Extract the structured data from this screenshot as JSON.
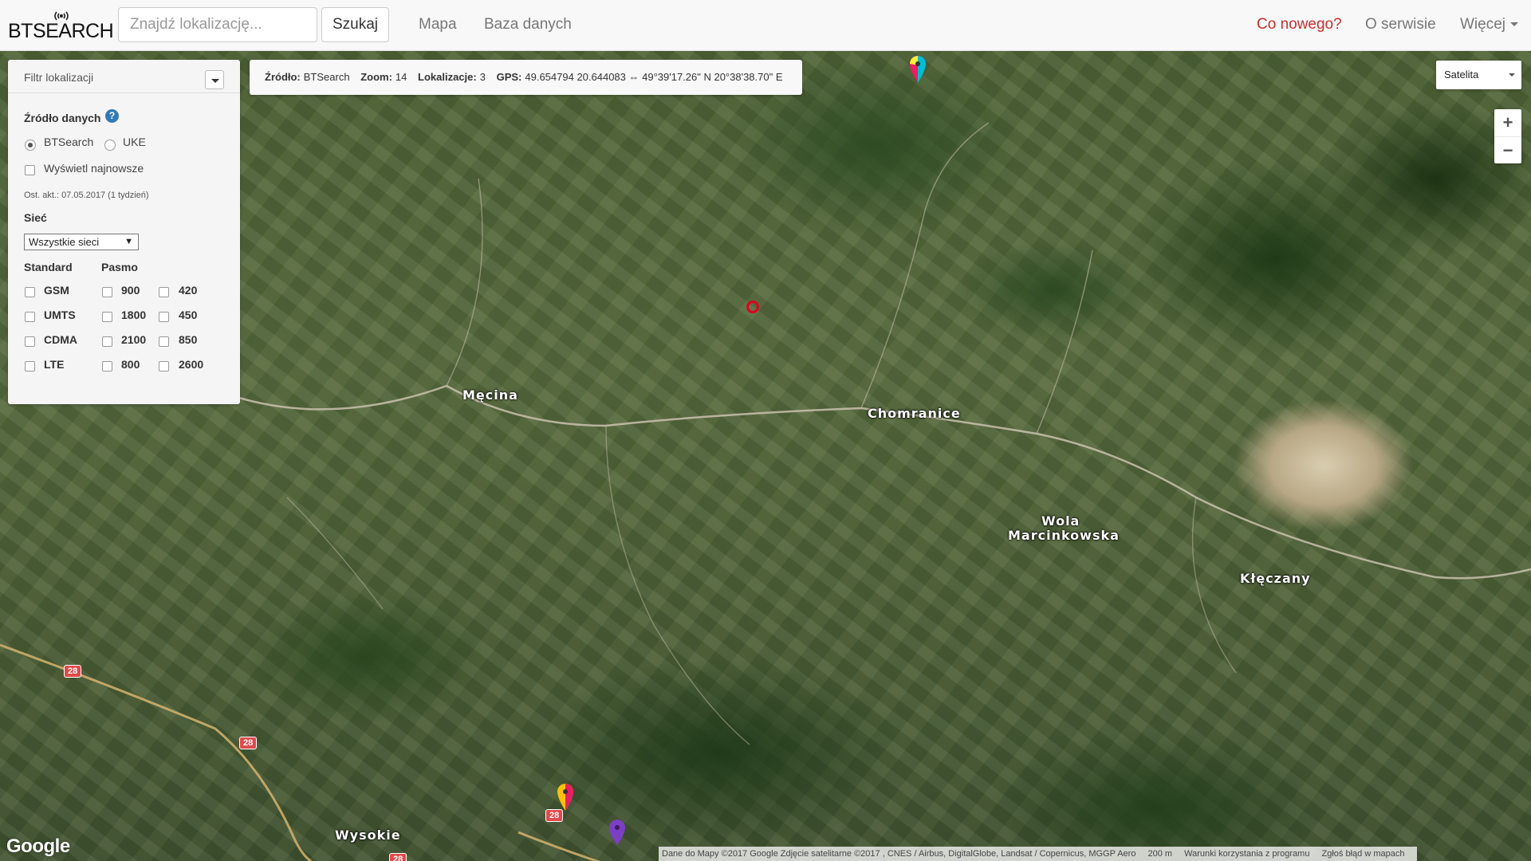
{
  "brand": {
    "name": "BTSEARCH"
  },
  "nav": {
    "search_placeholder": "Znajdź lokalizację...",
    "search_button": "Szukaj",
    "links": [
      "Mapa",
      "Baza danych"
    ],
    "whats_new": "Co nowego?",
    "about": "O serwisie",
    "more": "Więcej"
  },
  "filter": {
    "title": "Filtr lokalizacji",
    "data_source_label": "Źródło danych",
    "help": "?",
    "sources": [
      "BTSearch",
      "UKE"
    ],
    "selected_source": "BTSearch",
    "show_newest": "Wyświetl najnowsze",
    "last_update": "Ost. akt.: 07.05.2017 (1 tydzień)",
    "network_label": "Sieć",
    "network_value": "Wszystkie sieci",
    "standard_label": "Standard",
    "band_label": "Pasmo",
    "standards": [
      "GSM",
      "UMTS",
      "CDMA",
      "LTE"
    ],
    "bands_col1": [
      "900",
      "1800",
      "2100",
      "800"
    ],
    "bands_col2": [
      "420",
      "450",
      "850",
      "2600"
    ]
  },
  "info": {
    "source_label": "Źródło:",
    "source_value": "BTSearch",
    "zoom_label": "Zoom:",
    "zoom_value": "14",
    "locations_label": "Lokalizacje:",
    "locations_value": "3",
    "gps_label": "GPS:",
    "gps_value": "49.654794 20.644083 ⇔ 49°39'17.26\" N 20°38'38.70\" E"
  },
  "map": {
    "type": "Satelita",
    "zoom_in": "+",
    "zoom_out": "−",
    "places": [
      "Męcina",
      "Chomranice",
      "Wola",
      "Marcinkowska",
      "Kłęczany",
      "Wysokie"
    ],
    "road_number": "28",
    "google": "Google",
    "attribution": [
      "Dane do Mapy ©2017 Google Zdjęcie satelitarne ©2017 , CNES / Airbus, DigitalGlobe, Landsat / Copernicus, MGGP Aero",
      "200 m",
      "Warunki korzystania z programu",
      "Zgłoś błąd w mapach"
    ]
  }
}
